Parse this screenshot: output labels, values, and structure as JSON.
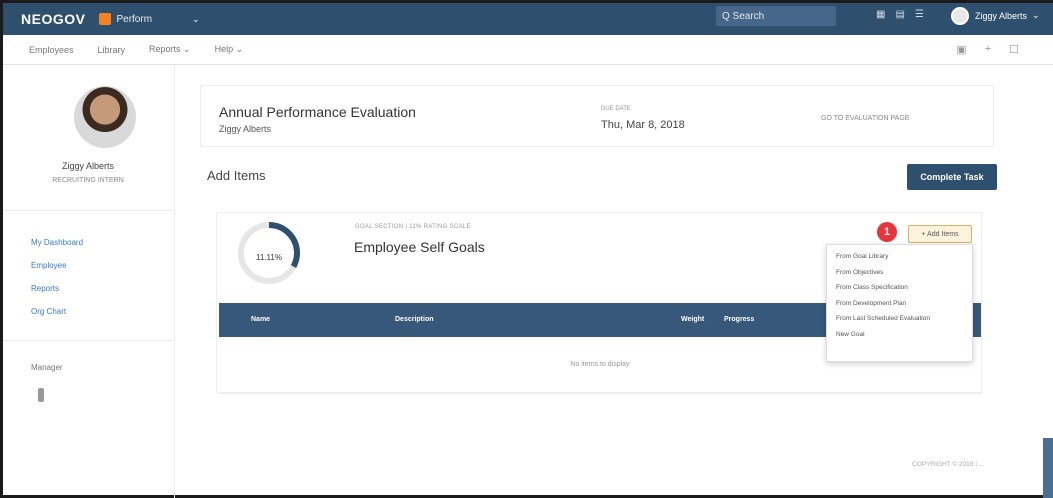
{
  "topbar": {
    "logo": "NEOGOV",
    "product": "Perform",
    "product_caret": "⌄",
    "search_placeholder": "Q Search",
    "icons": [
      "grid-icon",
      "calendar-icon",
      "list-icon"
    ],
    "user_name": "Ziggy Alberts",
    "user_caret": "⌄"
  },
  "menubar": {
    "items": [
      "Employees",
      "Library",
      "Reports ⌄",
      "Help ⌄"
    ],
    "right_icons": [
      "document-icon",
      "plus-icon",
      "settings-icon"
    ]
  },
  "sidebar": {
    "name": "Ziggy Alberts",
    "title": "RECRUITING INTERN",
    "links": [
      "My Dashboard",
      "Employee",
      "Reports",
      "Org Chart"
    ],
    "manager_label": "Manager"
  },
  "header": {
    "title": "Annual Performance Evaluation",
    "employee": "Ziggy Alberts",
    "due_label": "DUE DATE",
    "due_date": "Thu, Mar 8, 2018",
    "link": "GO TO EVALUATION PAGE"
  },
  "section_title": "Add Items",
  "complete_button": "Complete Task",
  "goals": {
    "kicker": "GOAL SECTION | 11% RATING SCALE",
    "name": "Employee Self Goals",
    "progress_label": "11.11%",
    "progress_fraction": 0.33,
    "badge": "1",
    "add_button": "+ Add Items",
    "table_headers": [
      "Name",
      "Description",
      "Weight",
      "Progress"
    ],
    "empty_text": "No items to display"
  },
  "dropdown": {
    "items": [
      "From Goal Library",
      "From Objectives",
      "From Class Specification",
      "From Development Plan",
      "From Last Scheduled Evaluation",
      "New Goal"
    ]
  },
  "footer": "COPYRIGHT © 2018 | ..."
}
